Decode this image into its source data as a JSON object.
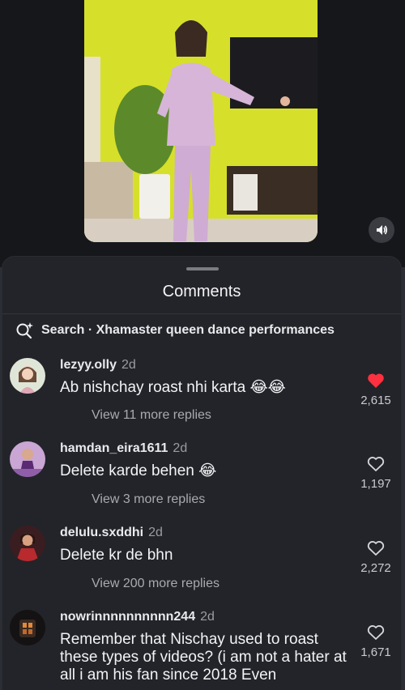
{
  "video": {
    "sound_icon": "volume-icon"
  },
  "comments_sheet": {
    "title": "Comments",
    "search_text": "Search · Xhamaster queen dance performances"
  },
  "comments": [
    {
      "username": "lezyy.olly",
      "time": "2d",
      "text": "Ab nishchay roast nhi karta 😂😂",
      "replies": "View 11 more replies",
      "likes": "2,615",
      "liked": true
    },
    {
      "username": "hamdan_eira1611",
      "time": "2d",
      "text": "Delete karde behen 😂",
      "replies": "View 3 more replies",
      "likes": "1,197",
      "liked": false
    },
    {
      "username": "delulu.sxddhi",
      "time": "2d",
      "text": "Delete kr de bhn",
      "replies": "View 200 more replies",
      "likes": "2,272",
      "liked": false
    },
    {
      "username": "nowrinnnnnnnnnn244",
      "time": "2d",
      "text": "Remember that Nischay used to roast these types of videos? (i am not a hater at all i am his fan since 2018 Even",
      "replies": "",
      "likes": "1,671",
      "liked": false
    }
  ],
  "colors": {
    "liked_heart": "#ff3040",
    "sheet_bg": "#222429"
  }
}
